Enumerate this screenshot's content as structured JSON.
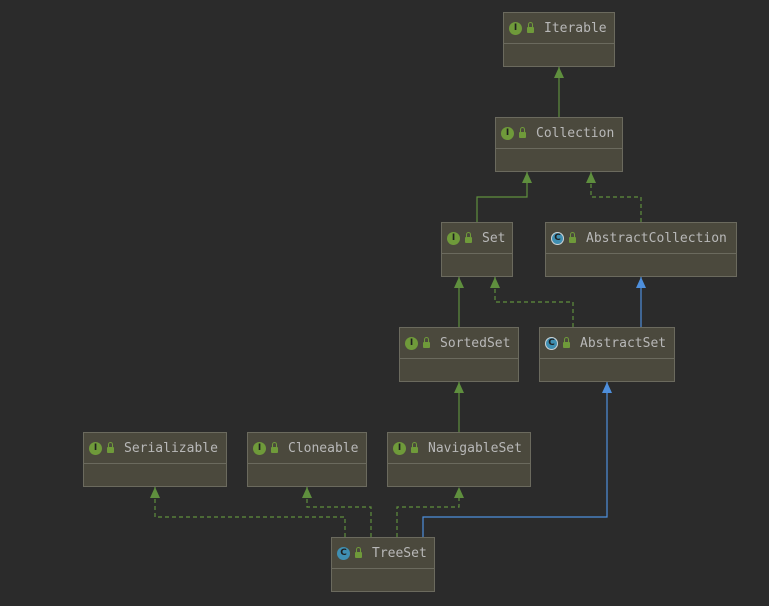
{
  "nodes": [
    {
      "id": "iterable",
      "kind": "interface",
      "badge": "I",
      "label": "Iterable"
    },
    {
      "id": "collection",
      "kind": "interface",
      "badge": "I",
      "label": "Collection"
    },
    {
      "id": "set",
      "kind": "interface",
      "badge": "I",
      "label": "Set"
    },
    {
      "id": "abstractcollection",
      "kind": "abstract",
      "badge": "C",
      "label": "AbstractCollection"
    },
    {
      "id": "sortedset",
      "kind": "interface",
      "badge": "I",
      "label": "SortedSet"
    },
    {
      "id": "abstractset",
      "kind": "abstract",
      "badge": "C",
      "label": "AbstractSet"
    },
    {
      "id": "serializable",
      "kind": "interface",
      "badge": "I",
      "label": "Serializable"
    },
    {
      "id": "cloneable",
      "kind": "interface",
      "badge": "I",
      "label": "Cloneable"
    },
    {
      "id": "navigableset",
      "kind": "interface",
      "badge": "I",
      "label": "NavigableSet"
    },
    {
      "id": "treeset",
      "kind": "class",
      "badge": "C",
      "label": "TreeSet"
    }
  ],
  "edges": [
    {
      "from": "collection",
      "to": "iterable",
      "type": "extends"
    },
    {
      "from": "set",
      "to": "collection",
      "type": "extends"
    },
    {
      "from": "abstractcollection",
      "to": "collection",
      "type": "implements"
    },
    {
      "from": "sortedset",
      "to": "set",
      "type": "extends"
    },
    {
      "from": "abstractset",
      "to": "set",
      "type": "implements"
    },
    {
      "from": "abstractset",
      "to": "abstractcollection",
      "type": "class-extends"
    },
    {
      "from": "navigableset",
      "to": "sortedset",
      "type": "extends"
    },
    {
      "from": "treeset",
      "to": "serializable",
      "type": "implements"
    },
    {
      "from": "treeset",
      "to": "cloneable",
      "type": "implements"
    },
    {
      "from": "treeset",
      "to": "navigableset",
      "type": "implements"
    },
    {
      "from": "treeset",
      "to": "abstractset",
      "type": "class-extends"
    }
  ],
  "colors": {
    "background": "#2b2b2b",
    "node_fill": "#4b493d",
    "node_border": "#6b6a5e",
    "interface_edge": "#5f8f3e",
    "class_edge": "#4e8fdc",
    "label": "#b8b8b8"
  }
}
